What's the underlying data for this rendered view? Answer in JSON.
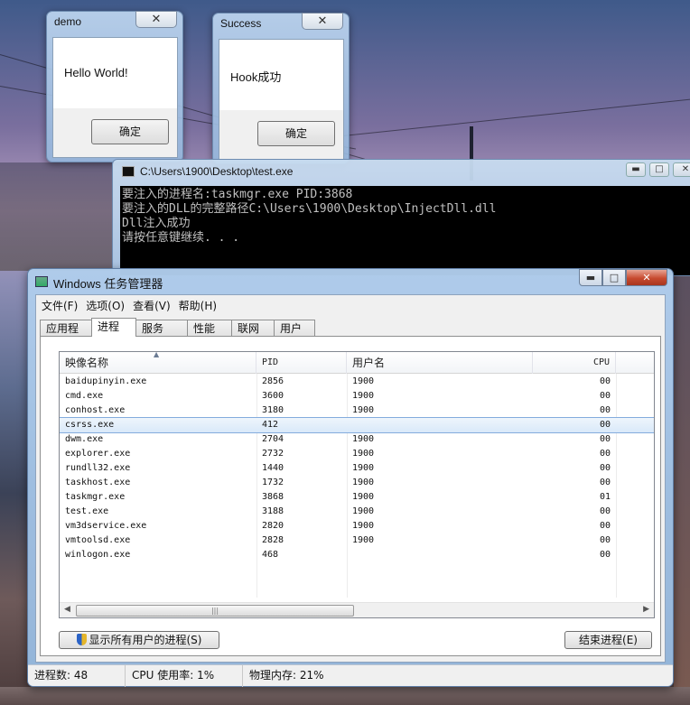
{
  "demo_dialog": {
    "title": "demo",
    "message": "Hello World!",
    "ok_label": "确定",
    "close_glyph": "✕"
  },
  "success_dialog": {
    "title": "Success",
    "message": "Hook成功",
    "ok_label": "确定",
    "close_glyph": "✕"
  },
  "console": {
    "title": "C:\\Users\\1900\\Desktop\\test.exe",
    "lines": [
      "要注入的进程名:taskmgr.exe PID:3868",
      "要注入的DLL的完整路径C:\\Users\\1900\\Desktop\\InjectDll.dll",
      "Dll注入成功",
      "请按任意键继续. . ."
    ]
  },
  "taskmgr": {
    "title": "Windows 任务管理器",
    "menu": [
      "文件(F)",
      "选项(O)",
      "查看(V)",
      "帮助(H)"
    ],
    "tabs": [
      "应用程序",
      "进程",
      "服务",
      "性能",
      "联网",
      "用户"
    ],
    "active_tab": "进程",
    "columns": {
      "name": "映像名称",
      "pid": "PID",
      "user": "用户名",
      "cpu": "CPU"
    },
    "processes": [
      {
        "name": "baidupinyin.exe",
        "pid": "2856",
        "user": "1900",
        "cpu": "00"
      },
      {
        "name": "cmd.exe",
        "pid": "3600",
        "user": "1900",
        "cpu": "00"
      },
      {
        "name": "conhost.exe",
        "pid": "3180",
        "user": "1900",
        "cpu": "00"
      },
      {
        "name": "csrss.exe",
        "pid": "412",
        "user": "",
        "cpu": "00"
      },
      {
        "name": "dwm.exe",
        "pid": "2704",
        "user": "1900",
        "cpu": "00"
      },
      {
        "name": "explorer.exe",
        "pid": "2732",
        "user": "1900",
        "cpu": "00"
      },
      {
        "name": "rundll32.exe",
        "pid": "1440",
        "user": "1900",
        "cpu": "00"
      },
      {
        "name": "taskhost.exe",
        "pid": "1732",
        "user": "1900",
        "cpu": "00"
      },
      {
        "name": "taskmgr.exe",
        "pid": "3868",
        "user": "1900",
        "cpu": "01"
      },
      {
        "name": "test.exe",
        "pid": "3188",
        "user": "1900",
        "cpu": "00"
      },
      {
        "name": "vm3dservice.exe",
        "pid": "2820",
        "user": "1900",
        "cpu": "00"
      },
      {
        "name": "vmtoolsd.exe",
        "pid": "2828",
        "user": "1900",
        "cpu": "00"
      },
      {
        "name": "winlogon.exe",
        "pid": "468",
        "user": "",
        "cpu": "00"
      }
    ],
    "selected_process": "csrss.exe",
    "show_all_button": "显示所有用户的进程(S)",
    "end_process_button": "结束进程(E)",
    "status": {
      "process_count": "进程数: 48",
      "cpu_usage": "CPU 使用率: 1%",
      "memory": "物理内存: 21%"
    }
  }
}
